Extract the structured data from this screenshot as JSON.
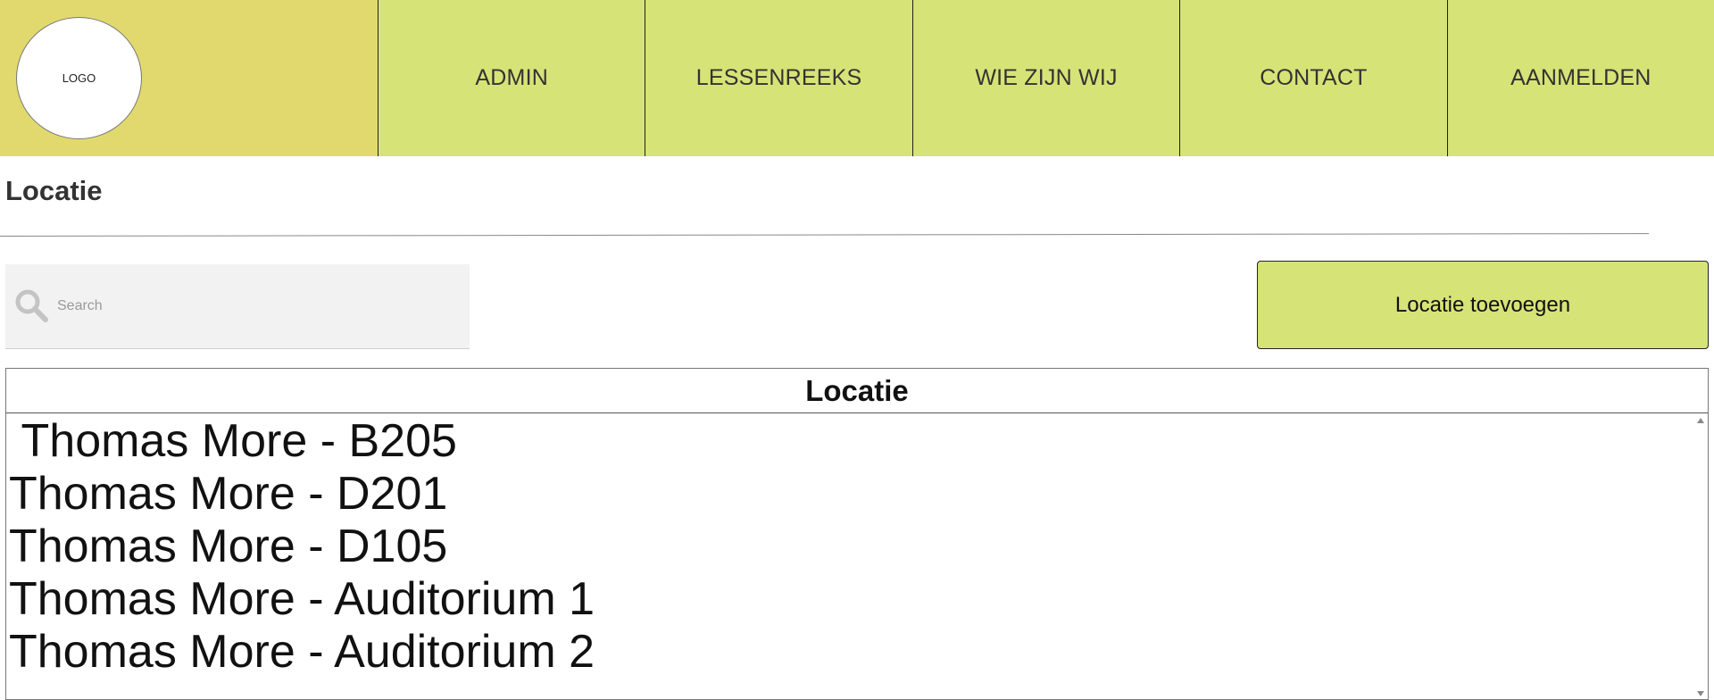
{
  "header": {
    "logo_text": "LOGO",
    "nav": [
      {
        "label": "ADMIN"
      },
      {
        "label": "LESSENREEKS"
      },
      {
        "label": "WIE ZIJN WIJ"
      },
      {
        "label": "CONTACT"
      },
      {
        "label": "AANMELDEN"
      }
    ],
    "colors": {
      "logo_bg": "#e2d96e",
      "nav_bg": "#d6e377"
    }
  },
  "page": {
    "title": "Locatie"
  },
  "search": {
    "placeholder": "Search",
    "value": "",
    "icon": "search-icon"
  },
  "actions": {
    "add_label": "Locatie toevoegen"
  },
  "table": {
    "header": "Locatie",
    "rows": [
      " Thomas More - B205",
      "Thomas More - D201",
      "Thomas More - D105",
      "Thomas More - Auditorium 1",
      "Thomas More - Auditorium 2"
    ]
  }
}
